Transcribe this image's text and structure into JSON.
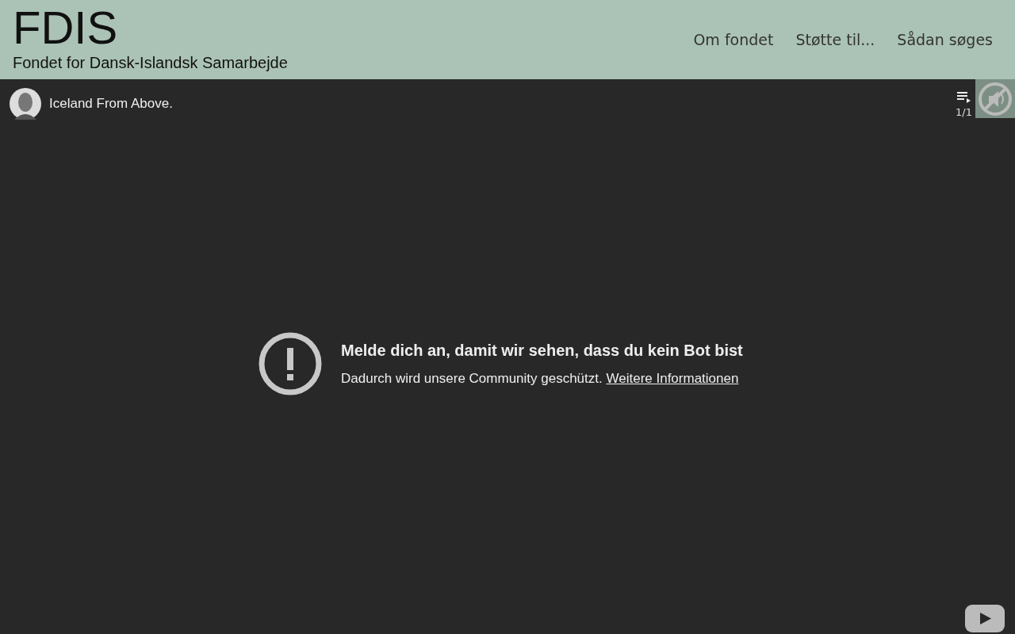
{
  "header": {
    "logo": "FDIS",
    "subtitle": "Fondet for Dansk-Islandsk Samarbejde",
    "nav": [
      {
        "label": "Om fondet"
      },
      {
        "label": "Støtte til..."
      },
      {
        "label": "Sådan søges"
      }
    ]
  },
  "video": {
    "title": "Iceland From Above.",
    "playlist_count": "1/1",
    "message": {
      "heading": "Melde dich an, damit wir sehen, dass du kein Bot bist",
      "text": "Dadurch wird unsere Community geschützt.",
      "link": "Weitere Informationen"
    }
  }
}
